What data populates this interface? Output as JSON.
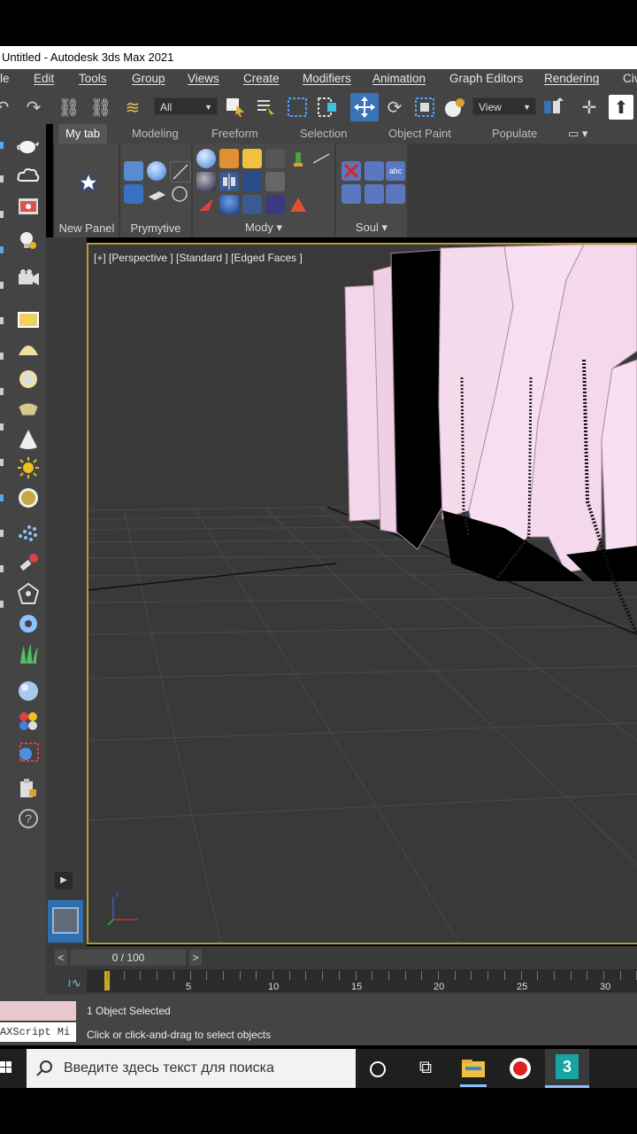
{
  "window": {
    "title": "Untitled - Autodesk 3ds Max 2021"
  },
  "menu": [
    "le",
    "Edit",
    "Tools",
    "Group",
    "Views",
    "Create",
    "Modifiers",
    "Animation",
    "Graph Editors",
    "Rendering",
    "Civ"
  ],
  "toolbar": {
    "selection_filter": "All",
    "ref_coord": "View"
  },
  "ribbon": {
    "tabs": [
      "My tab",
      "Modeling",
      "Freeform",
      "Selection",
      "Object Paint",
      "Populate"
    ],
    "panels": [
      "New Panel",
      "Prymytive",
      "Mody",
      "Soul"
    ]
  },
  "viewport": {
    "label": "[+] [Perspective ] [Standard ] [Edged Faces ]"
  },
  "timeline": {
    "frame_counter": "0 / 100",
    "ticks": [
      "5",
      "10",
      "15",
      "20",
      "25",
      "30"
    ]
  },
  "status": {
    "objects": "1 Object Selected",
    "hint": "Click or click-and-drag to select objects",
    "script_mini": "AXScript Mi"
  },
  "taskbar": {
    "search_placeholder": "Введите здесь текст для поиска"
  },
  "colors": {
    "viewport_border": "#b59b2f",
    "object_pink": "#f2d6ea",
    "accent_blue": "#3a73b8"
  }
}
